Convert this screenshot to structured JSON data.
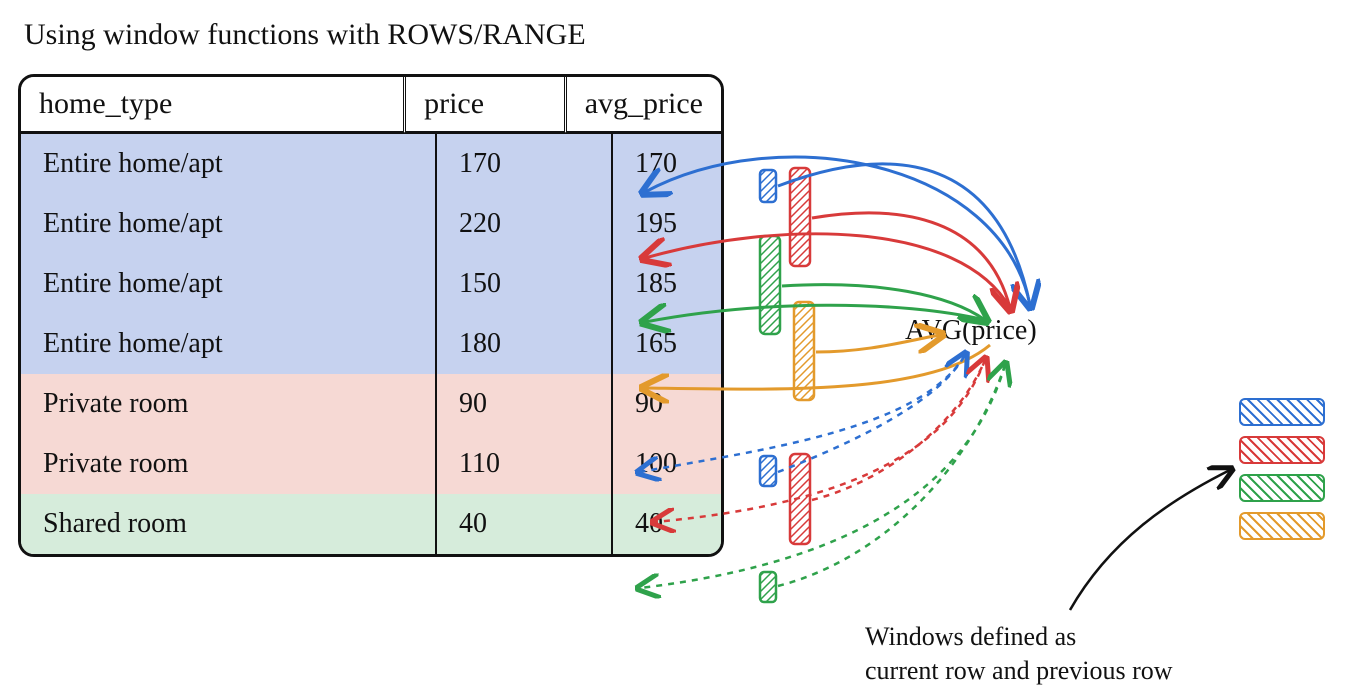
{
  "title": "Using window functions with ROWS/RANGE",
  "columns": {
    "c0": "home_type",
    "c1": "price",
    "c2": "avg_price"
  },
  "groups": [
    {
      "tint": "#c6d2ef",
      "rows": [
        {
          "home_type": "Entire home/apt",
          "price": "170",
          "avg_price": "170"
        },
        {
          "home_type": "Entire home/apt",
          "price": "220",
          "avg_price": "195"
        },
        {
          "home_type": "Entire home/apt",
          "price": "150",
          "avg_price": "185"
        },
        {
          "home_type": "Entire home/apt",
          "price": "180",
          "avg_price": "165"
        }
      ]
    },
    {
      "tint": "#f6d9d4",
      "rows": [
        {
          "home_type": "Private room",
          "price": "90",
          "avg_price": "90"
        },
        {
          "home_type": "Private room",
          "price": "110",
          "avg_price": "100"
        }
      ]
    },
    {
      "tint": "#d6ecdb",
      "rows": [
        {
          "home_type": "Shared room",
          "price": "40",
          "avg_price": "40"
        }
      ]
    }
  ],
  "avg_label": "AVG(price)",
  "caption_line1": "Windows defined as",
  "caption_line2": "current row and previous row",
  "colors": {
    "blue": "#2d6fd1",
    "red": "#d83a3a",
    "green": "#2fa24b",
    "orange": "#e39a2c"
  },
  "legend": [
    "blue",
    "red",
    "green",
    "orange"
  ]
}
